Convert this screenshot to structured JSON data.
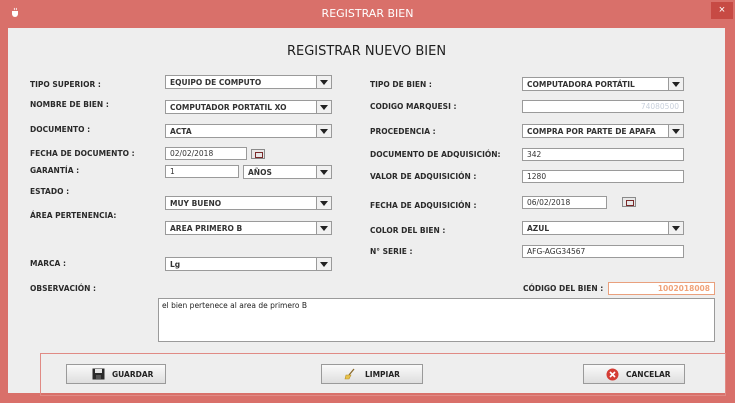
{
  "window": {
    "title": "REGISTRAR BIEN",
    "close_glyph": "×",
    "app_icon": "java-cup-icon"
  },
  "form": {
    "heading": "REGISTRAR NUEVO BIEN",
    "left": {
      "tipo_superior": {
        "label": "TIPO SUPERIOR :",
        "value": "EQUIPO DE COMPUTO"
      },
      "nombre_bien": {
        "label": "NOMBRE DE BIEN :",
        "value": "COMPUTADOR PORTATIL XO"
      },
      "documento": {
        "label": "DOCUMENTO :",
        "value": "ACTA"
      },
      "fecha_documento": {
        "label": "FECHA DE DOCUMENTO :",
        "value": "02/02/2018"
      },
      "garantia": {
        "label": "GARANTÍA :",
        "value": "1",
        "unit": "AÑOS"
      },
      "estado": {
        "label": "ESTADO :",
        "value": "MUY BUENO"
      },
      "area": {
        "label": "ÁREA PERTENENCIA:",
        "value": "AREA PRIMERO B"
      },
      "marca": {
        "label": "MARCA :",
        "value": "Lg"
      }
    },
    "right": {
      "tipo_bien": {
        "label": "TIPO DE BIEN :",
        "value": "COMPUTADORA PORTÁTIL"
      },
      "codigo_marquesi": {
        "label": "CODIGO MARQUESI :",
        "value": "74080500"
      },
      "procedencia": {
        "label": "PROCEDENCIA :",
        "value": "COMPRA POR PARTE DE APAFA"
      },
      "documento_adquisicion": {
        "label": "DOCUMENTO DE ADQUISICIÓN:",
        "value": "342"
      },
      "valor_adquisicion": {
        "label": "VALOR DE ADQUISICIÓN :",
        "value": "1280"
      },
      "fecha_adquisicion": {
        "label": "FECHA DE ADQUISICIÓN :",
        "value": "06/02/2018"
      },
      "color_bien": {
        "label": "COLOR DEL BIEN :",
        "value": "AZUL"
      },
      "n_serie": {
        "label": "N° SERIE :",
        "value": "AFG-AGG34567"
      }
    },
    "observacion": {
      "label": "OBSERVACIÓN :",
      "value": "el bien pertenece al area de primero B"
    },
    "codigo_bien": {
      "label": "CÓDIGO DEL BIEN :",
      "value": "1002018008"
    }
  },
  "buttons": {
    "guardar": {
      "label": "GUARDAR",
      "icon": "floppy-disk-icon"
    },
    "limpiar": {
      "label": "LIMPIAR",
      "icon": "broom-icon"
    },
    "cancelar": {
      "label": "CANCELAR",
      "icon": "cancel-circle-icon"
    }
  },
  "colors": {
    "frame": "#d9706a",
    "close": "#c74a44",
    "readonly_text": "#f0a37a"
  }
}
